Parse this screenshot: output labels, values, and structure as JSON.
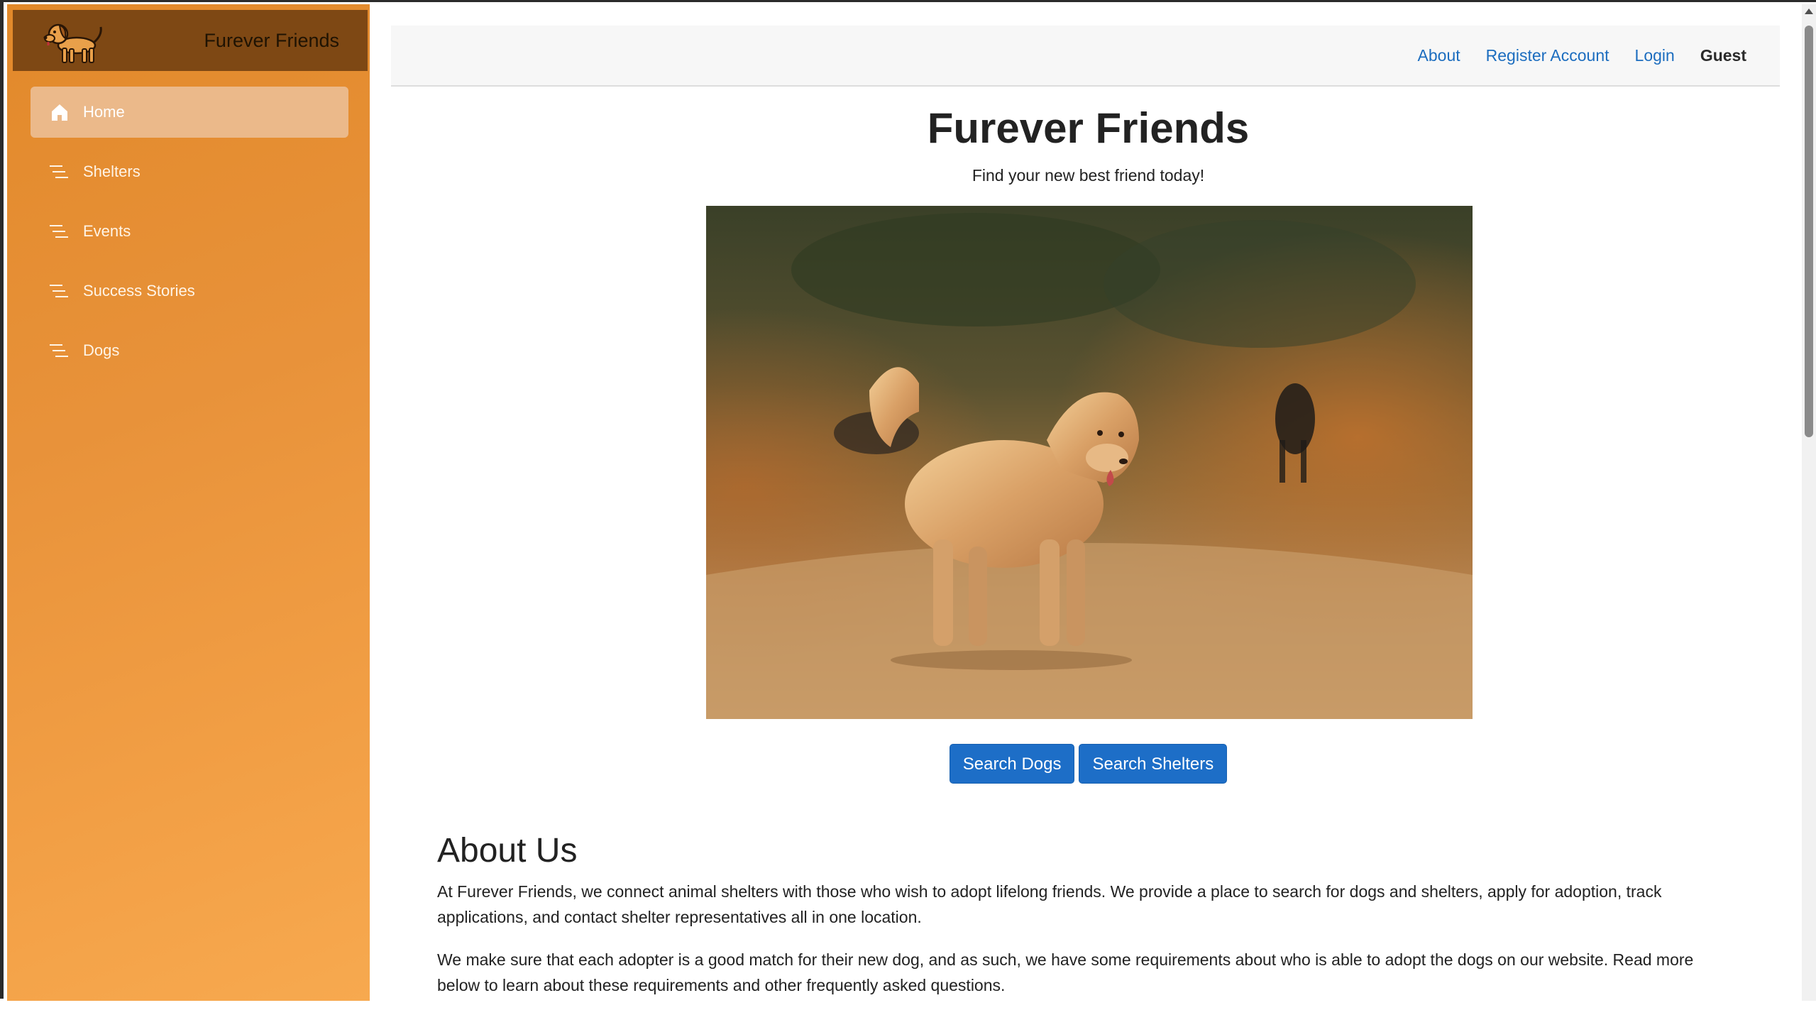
{
  "brand": {
    "title": "Furever Friends",
    "logo_icon": "dog-icon"
  },
  "sidebar": {
    "items": [
      {
        "label": "Home",
        "icon": "home-icon",
        "active": true
      },
      {
        "label": "Shelters",
        "icon": "list-icon",
        "active": false
      },
      {
        "label": "Events",
        "icon": "list-icon",
        "active": false
      },
      {
        "label": "Success Stories",
        "icon": "list-icon",
        "active": false
      },
      {
        "label": "Dogs",
        "icon": "list-icon",
        "active": false
      }
    ]
  },
  "topnav": {
    "about": "About",
    "register": "Register Account",
    "login": "Login",
    "user": "Guest"
  },
  "hero": {
    "title": "Furever Friends",
    "subtitle": "Find your new best friend today!",
    "photo_alt": "golden retriever on a dirt path"
  },
  "actions": {
    "search_dogs": "Search Dogs",
    "search_shelters": "Search Shelters"
  },
  "about": {
    "heading": "About Us",
    "paragraphs": [
      "At Furever Friends, we connect animal shelters with those who wish to adopt lifelong friends. We provide a place to search for dogs and shelters, apply for adoption, track applications, and contact shelter representatives all in one location.",
      "We make sure that each adopter is a good match for their new dog, and as such, we have some requirements about who is able to adopt the dogs on our website. Read more below to learn about these requirements and other frequently asked questions."
    ]
  },
  "colors": {
    "sidebar": "#e8923a",
    "brand_bar": "#7e4814",
    "link": "#1c6dbf",
    "button": "#1d6ec7"
  }
}
